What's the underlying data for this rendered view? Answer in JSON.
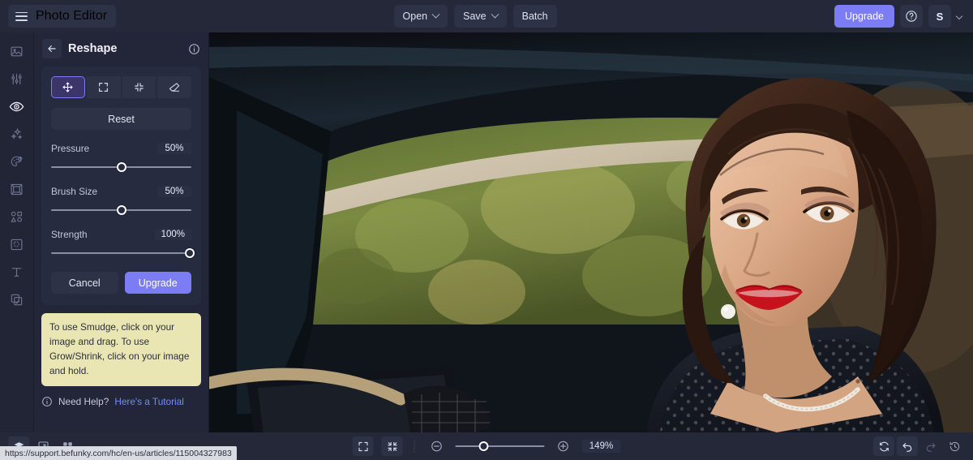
{
  "topbar": {
    "brand": "Photo Editor",
    "menu_icon": "hamburger-icon",
    "open_label": "Open",
    "save_label": "Save",
    "batch_label": "Batch",
    "upgrade_label": "Upgrade",
    "help_icon": "question-circle-icon",
    "avatar_letter": "S",
    "accent_color": "#7c7cf5"
  },
  "rail": {
    "items": [
      {
        "name": "image",
        "icon": "image-icon",
        "active": false
      },
      {
        "name": "edit",
        "icon": "sliders-icon",
        "active": false
      },
      {
        "name": "touch-up",
        "icon": "eye-icon",
        "active": true
      },
      {
        "name": "effects",
        "icon": "sparkles-icon",
        "active": false
      },
      {
        "name": "artsy",
        "icon": "palette-icon",
        "active": false
      },
      {
        "name": "frames",
        "icon": "frame-icon",
        "active": false
      },
      {
        "name": "overlays",
        "icon": "shapes-icon",
        "active": false
      },
      {
        "name": "textures",
        "icon": "texture-icon",
        "active": false
      },
      {
        "name": "text",
        "icon": "text-icon",
        "active": false
      },
      {
        "name": "graphics",
        "icon": "graphics-icon",
        "active": false
      }
    ]
  },
  "panel": {
    "back_icon": "arrow-left-icon",
    "title": "Reshape",
    "info_icon": "info-circle-icon",
    "tools": [
      {
        "name": "smudge",
        "icon": "move-arrows-icon",
        "active": true
      },
      {
        "name": "grow",
        "icon": "expand-arrows-icon",
        "active": false
      },
      {
        "name": "shrink",
        "icon": "contract-arrows-icon",
        "active": false
      },
      {
        "name": "restore",
        "icon": "eraser-icon",
        "active": false
      }
    ],
    "reset_label": "Reset",
    "sliders": [
      {
        "label": "Pressure",
        "value": "50%",
        "percent": 50
      },
      {
        "label": "Brush Size",
        "value": "50%",
        "percent": 50
      },
      {
        "label": "Strength",
        "value": "100%",
        "percent": 100
      }
    ],
    "cancel_label": "Cancel",
    "apply_label": "Upgrade",
    "tip_text": "To use Smudge, click on your image and drag. To use Grow/Shrink, click on your image and hold.",
    "tip_bg": "#eae6b4",
    "help_icon": "info-circle-icon",
    "help_label": "Need Help?",
    "help_link": "Here's a Tutorial"
  },
  "bottombar": {
    "left_icons": [
      {
        "name": "layers",
        "icon": "layers-icon",
        "active": true
      },
      {
        "name": "compare",
        "icon": "compare-icon",
        "active": false
      },
      {
        "name": "grid",
        "icon": "grid-icon",
        "active": false
      }
    ],
    "fullscreen_icon": "fullscreen-icon",
    "fit_icon": "fit-screen-icon",
    "zoom_out_icon": "zoom-out-icon",
    "zoom_in_icon": "zoom-in-icon",
    "zoom_percent_label": "149%",
    "zoom_slider_percent": 32,
    "right_icons": [
      {
        "name": "reset-view",
        "icon": "refresh-icon",
        "dim": false,
        "filled": true
      },
      {
        "name": "undo",
        "icon": "undo-icon",
        "dim": false,
        "filled": true
      },
      {
        "name": "redo",
        "icon": "redo-icon",
        "dim": true,
        "filled": false
      },
      {
        "name": "history",
        "icon": "history-icon",
        "dim": false,
        "filled": false
      }
    ]
  },
  "statusbar": {
    "url": "https://support.befunky.com/hc/en-us/articles/115004327983"
  },
  "photo": {
    "description": "Woman with dark wavy hair, red lipstick and polka-dot dress seated in a vintage car",
    "colors": {
      "car_body_dark": "#10151b",
      "window_trim": "#cfc6b4",
      "foliage": "#6f7d3c",
      "skin": "#d8aa8c",
      "hair": "#2c1a13",
      "lips": "#c6121c",
      "dress": "#171a22"
    }
  }
}
